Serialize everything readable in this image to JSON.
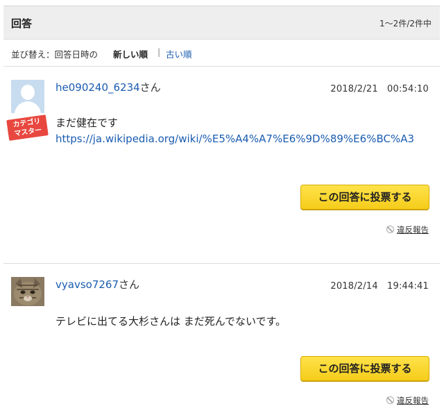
{
  "header": {
    "title": "回答",
    "count": "1〜2件/2件中"
  },
  "sort": {
    "prefix": "並び替え：回答日時の",
    "current": "新しい順",
    "separator": "|",
    "alt": "古い順"
  },
  "answers": [
    {
      "username": "he090240_6234",
      "suffix": "さん",
      "badge": "カテゴリマスター",
      "badge_line1": "カテゴリ",
      "badge_line2": "マスター",
      "datetime": "2018/2/21　00:54:10",
      "text": "まだ健在です",
      "link": "https://ja.wikipedia.org/wiki/%E5%A4%A7%E6%9D%89%E6%BC%A3",
      "vote_label": "この回答に投票する",
      "report_label": "違反報告"
    },
    {
      "username": "vyavso7267",
      "suffix": "さん",
      "datetime": "2018/2/14　19:44:41",
      "text": "テレビに出てる大杉さんは まだ死んでないです。",
      "vote_label": "この回答に投票する",
      "report_label": "違反報告"
    }
  ],
  "colors": {
    "link": "#1a5cb0",
    "vote_button": "#f5cc1a",
    "badge": "#e8473f",
    "header_bg": "#eeeeee"
  }
}
